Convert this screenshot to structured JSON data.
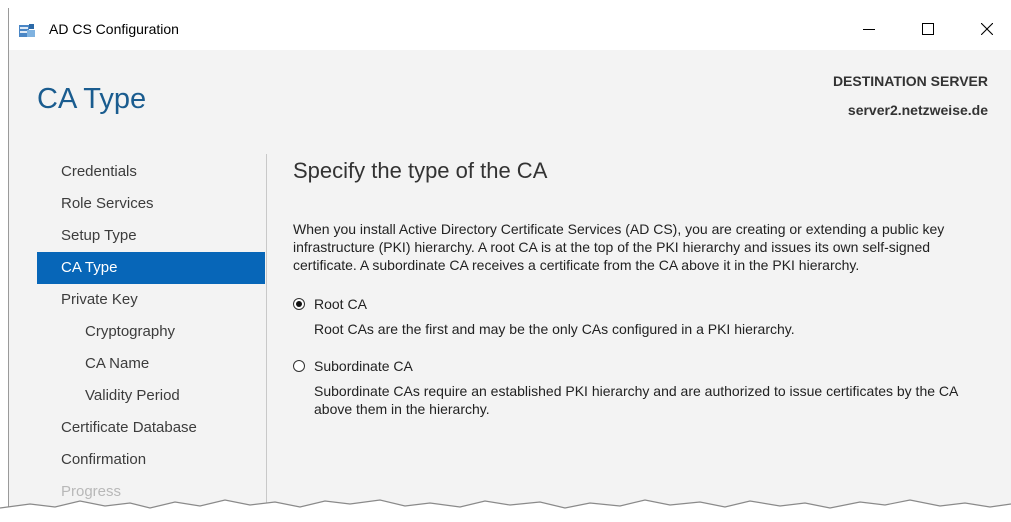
{
  "window": {
    "title": "AD CS Configuration",
    "icon": "server-config-icon",
    "controls": {
      "minimize": "minimize-icon",
      "maximize": "maximize-icon",
      "close": "close-icon"
    }
  },
  "header": {
    "page_title": "CA Type",
    "destination_label": "DESTINATION SERVER",
    "destination_server": "server2.netzweise.de"
  },
  "nav": {
    "items": [
      {
        "label": "Credentials"
      },
      {
        "label": "Role Services"
      },
      {
        "label": "Setup Type"
      },
      {
        "label": "CA Type",
        "active": true
      },
      {
        "label": "Private Key"
      },
      {
        "label": "Cryptography",
        "sub": true
      },
      {
        "label": "CA Name",
        "sub": true
      },
      {
        "label": "Validity Period",
        "sub": true
      },
      {
        "label": "Certificate Database"
      },
      {
        "label": "Confirmation"
      },
      {
        "label": "Progress",
        "disabled": true
      }
    ]
  },
  "main": {
    "section_title": "Specify the type of the CA",
    "description": "When you install Active Directory Certificate Services (AD CS), you are creating or extending a public key infrastructure (PKI) hierarchy. A root CA is at the top of the PKI hierarchy and issues its own self-signed certificate. A subordinate CA receives a certificate from the CA above it in the PKI hierarchy.",
    "options": [
      {
        "label": "Root CA",
        "checked": true,
        "description": "Root CAs are the first and may be the only CAs configured in a PKI hierarchy."
      },
      {
        "label": "Subordinate CA",
        "checked": false,
        "description": "Subordinate CAs require an established PKI hierarchy and are authorized to issue certificates by the CA above them in the hierarchy."
      }
    ]
  },
  "colors": {
    "accent": "#0766b8",
    "title": "#1a5c8f",
    "background": "#f3f3f3"
  }
}
